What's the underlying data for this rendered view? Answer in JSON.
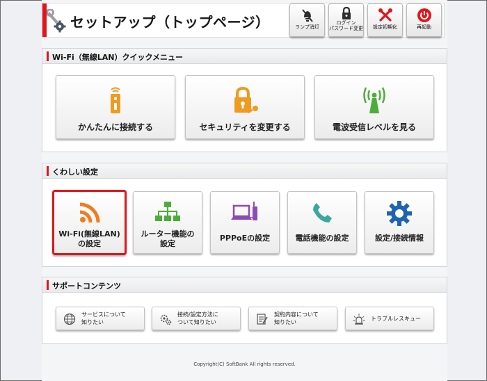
{
  "header": {
    "title": "セットアップ（トップページ）",
    "buttons": [
      {
        "label": "ランプ消灯",
        "icon": "lamp-off-icon"
      },
      {
        "label": "ログイン\nパスワード変更",
        "label_line1": "ログイン",
        "label_line2": "パスワード変更",
        "icon": "lock-icon"
      },
      {
        "label": "設定初期化",
        "icon": "tools-icon"
      },
      {
        "label": "再起動",
        "icon": "power-icon"
      }
    ]
  },
  "quick_menu": {
    "heading": "Wi-Fi（無線LAN）クイックメニュー",
    "buttons": [
      {
        "label": "かんたんに接続する",
        "icon": "wps-device-icon"
      },
      {
        "label": "セキュリティを変更する",
        "icon": "padlock-key-icon"
      },
      {
        "label": "電波受信レベルを見る",
        "icon": "antenna-icon"
      }
    ]
  },
  "advanced": {
    "heading": "くわしい設定",
    "buttons": [
      {
        "label_line1": "Wi-Fi(無線LAN)",
        "label_line2": "の設定",
        "icon": "wifi-icon",
        "selected": true
      },
      {
        "label_line1": "ルーター機能の",
        "label_line2": "設定",
        "icon": "network-tree-icon"
      },
      {
        "label_line1": "PPPoEの設定",
        "label_line2": "",
        "icon": "pc-router-icon"
      },
      {
        "label_line1": "電話機能の設定",
        "label_line2": "",
        "icon": "phone-icon"
      },
      {
        "label_line1": "設定/接続情報",
        "label_line2": "",
        "icon": "gear-icon"
      }
    ]
  },
  "support": {
    "heading": "サポートコンテンツ",
    "buttons": [
      {
        "label": "サービスについて\n知りたい",
        "icon": "globe-icon"
      },
      {
        "label": "接続/設定方法に\nついて知りたい",
        "icon": "gears-icon"
      },
      {
        "label": "契約内容について\n知りたい",
        "icon": "document-pen-icon"
      },
      {
        "label": "トラブルレスキュー",
        "icon": "alert-lamp-icon"
      }
    ]
  },
  "footer": {
    "copyright": "Copyright(C) SoftBank All rights reserved."
  },
  "colors": {
    "accent_red": "#e0161b",
    "wifi_orange": "#f07c1e",
    "green": "#4cae3a",
    "purple": "#8a4bb5",
    "teal": "#3aa89a",
    "blue": "#1d63b4"
  }
}
